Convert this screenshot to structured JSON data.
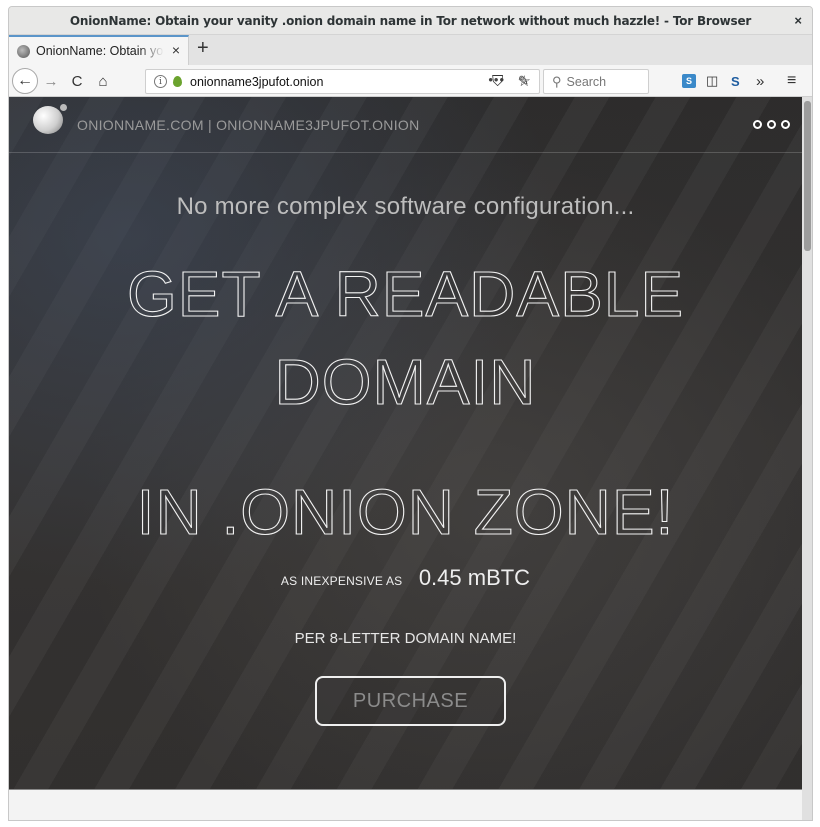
{
  "window": {
    "title": "OnionName: Obtain your vanity .onion domain name in Tor network without much hazzle! - Tor Browser",
    "close_label": "×"
  },
  "tabs": [
    {
      "label": "OnionName: Obtain your vanity .onion domain name in Tor network without much hazzle!",
      "close_label": "×",
      "active": true
    }
  ],
  "new_tab_label": "+",
  "navbar": {
    "back_glyph": "←",
    "forward_glyph": "→",
    "reload_glyph": "C",
    "home_glyph": "⌂",
    "url": "onionname3jpufot.onion",
    "page_actions_glyph": "•••",
    "bookmark_glyph": "☆",
    "shield_glyph": "⛉",
    "noscript_glyph": "✎",
    "search_placeholder": "Search",
    "search_glyph": "⚲",
    "ext1_label": "S",
    "sidebar_glyph": "◫",
    "ext2_label": "S",
    "overflow_glyph": "»",
    "menu_glyph": "≡"
  },
  "site": {
    "brand": "ONIONNAME.COM  |  ONIONNAME3JPUFOT.ONION",
    "tagline": "No more complex software configuration...",
    "headline": [
      "GET A READABLE",
      "DOMAIN",
      "IN .ONION ZONE!"
    ],
    "price_label": "AS INEXPENSIVE AS",
    "price_value": "0.45 mBTC",
    "per_line": "PER 8-LETTER DOMAIN NAME!",
    "purchase_label": "PURCHASE"
  }
}
